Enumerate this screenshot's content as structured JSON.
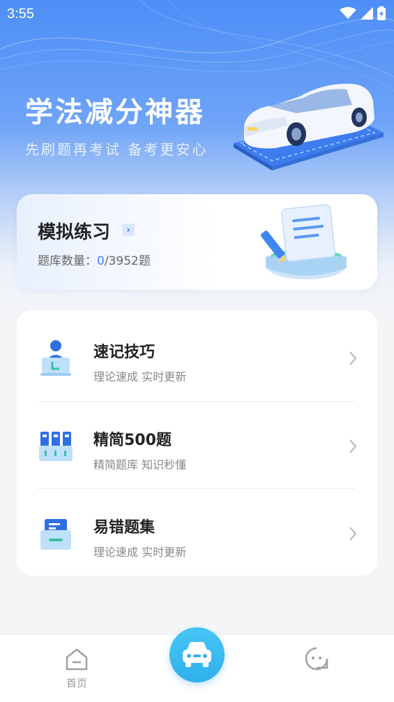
{
  "status_bar": {
    "time": "3:55"
  },
  "hero": {
    "title": "学法减分神器",
    "subtitle": "先刷题再考试 备考更安心"
  },
  "practice": {
    "title": "模拟练习",
    "arrow": "›",
    "count_label": "题库数量：",
    "done": "0",
    "total": "/3952题"
  },
  "list": [
    {
      "title": "速记技巧",
      "subtitle": "理论速成 实时更新",
      "icon": "person-computer-icon"
    },
    {
      "title": "精简500题",
      "subtitle": "精简题库 知识秒懂",
      "icon": "file-cabinet-icon"
    },
    {
      "title": "易错题集",
      "subtitle": "理论速成 实时更新",
      "icon": "drawer-box-icon"
    }
  ],
  "tabbar": {
    "home_label": "首页",
    "icons": [
      "home-icon",
      "car-icon",
      "smiley-icon"
    ]
  },
  "colors": {
    "accent": "#3e84f0",
    "tab_accent": "#2fb0ec"
  }
}
